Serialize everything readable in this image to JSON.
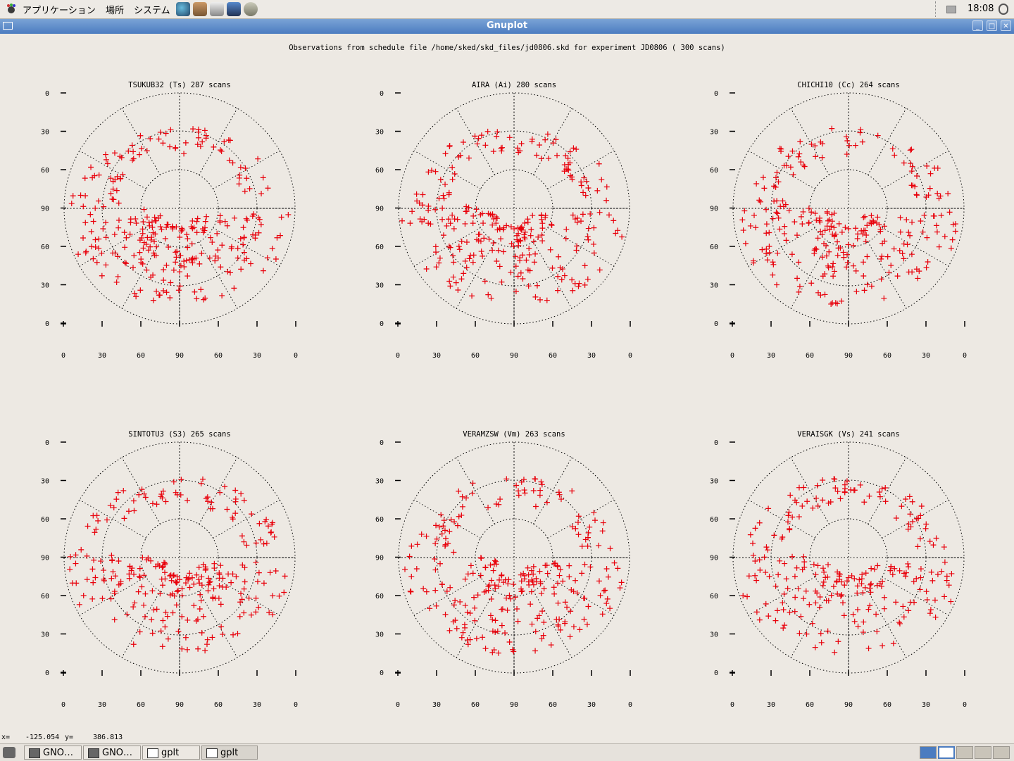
{
  "top_panel": {
    "menus": [
      "アプリケーション",
      "場所",
      "システム"
    ],
    "clock": "18:08",
    "launchers": [
      "browser-icon",
      "file-manager-icon",
      "editor-icon",
      "presentation-icon",
      "mail-icon"
    ]
  },
  "window": {
    "title": "Gnuplot"
  },
  "plot": {
    "main_title": "Observations from schedule file /home/sked/skd_files/jd0806.skd for experiment JD0806    ( 300 scans)",
    "y_ticks": [
      "0",
      "30",
      "60",
      "90",
      "60",
      "30",
      "0"
    ],
    "x_ticks": [
      "0",
      "30",
      "60",
      "90",
      "60",
      "30",
      "0"
    ]
  },
  "chart_data": [
    {
      "type": "scatter",
      "title": "TSUKUB32 (Ts)  287 scans",
      "scans": 287,
      "xlim": [
        0,
        180
      ],
      "ylim": [
        0,
        180
      ]
    },
    {
      "type": "scatter",
      "title": "AIRA (Ai)  280 scans",
      "scans": 280,
      "xlim": [
        0,
        180
      ],
      "ylim": [
        0,
        180
      ]
    },
    {
      "type": "scatter",
      "title": "CHICHI10 (Cc)  264 scans",
      "scans": 264,
      "xlim": [
        0,
        180
      ],
      "ylim": [
        0,
        180
      ]
    },
    {
      "type": "scatter",
      "title": "SINTOTU3 (S3)  265 scans",
      "scans": 265,
      "xlim": [
        0,
        180
      ],
      "ylim": [
        0,
        180
      ]
    },
    {
      "type": "scatter",
      "title": "VERAMZSW (Vm)  263 scans",
      "scans": 263,
      "xlim": [
        0,
        180
      ],
      "ylim": [
        0,
        180
      ]
    },
    {
      "type": "scatter",
      "title": "VERAISGK (Vs)  241 scans",
      "scans": 241,
      "xlim": [
        0,
        180
      ],
      "ylim": [
        0,
        180
      ]
    }
  ],
  "status_bar": {
    "x_label": "x=",
    "x_value": "-125.054",
    "y_label": "y=",
    "y_value": "386.813"
  },
  "taskbar": {
    "items": [
      "GNO…",
      "GNO…",
      "gplt",
      "gplt"
    ]
  },
  "colors": {
    "marker": "#e8000b",
    "title_bar": "#4b7cc0",
    "background": "#ede9e3"
  }
}
